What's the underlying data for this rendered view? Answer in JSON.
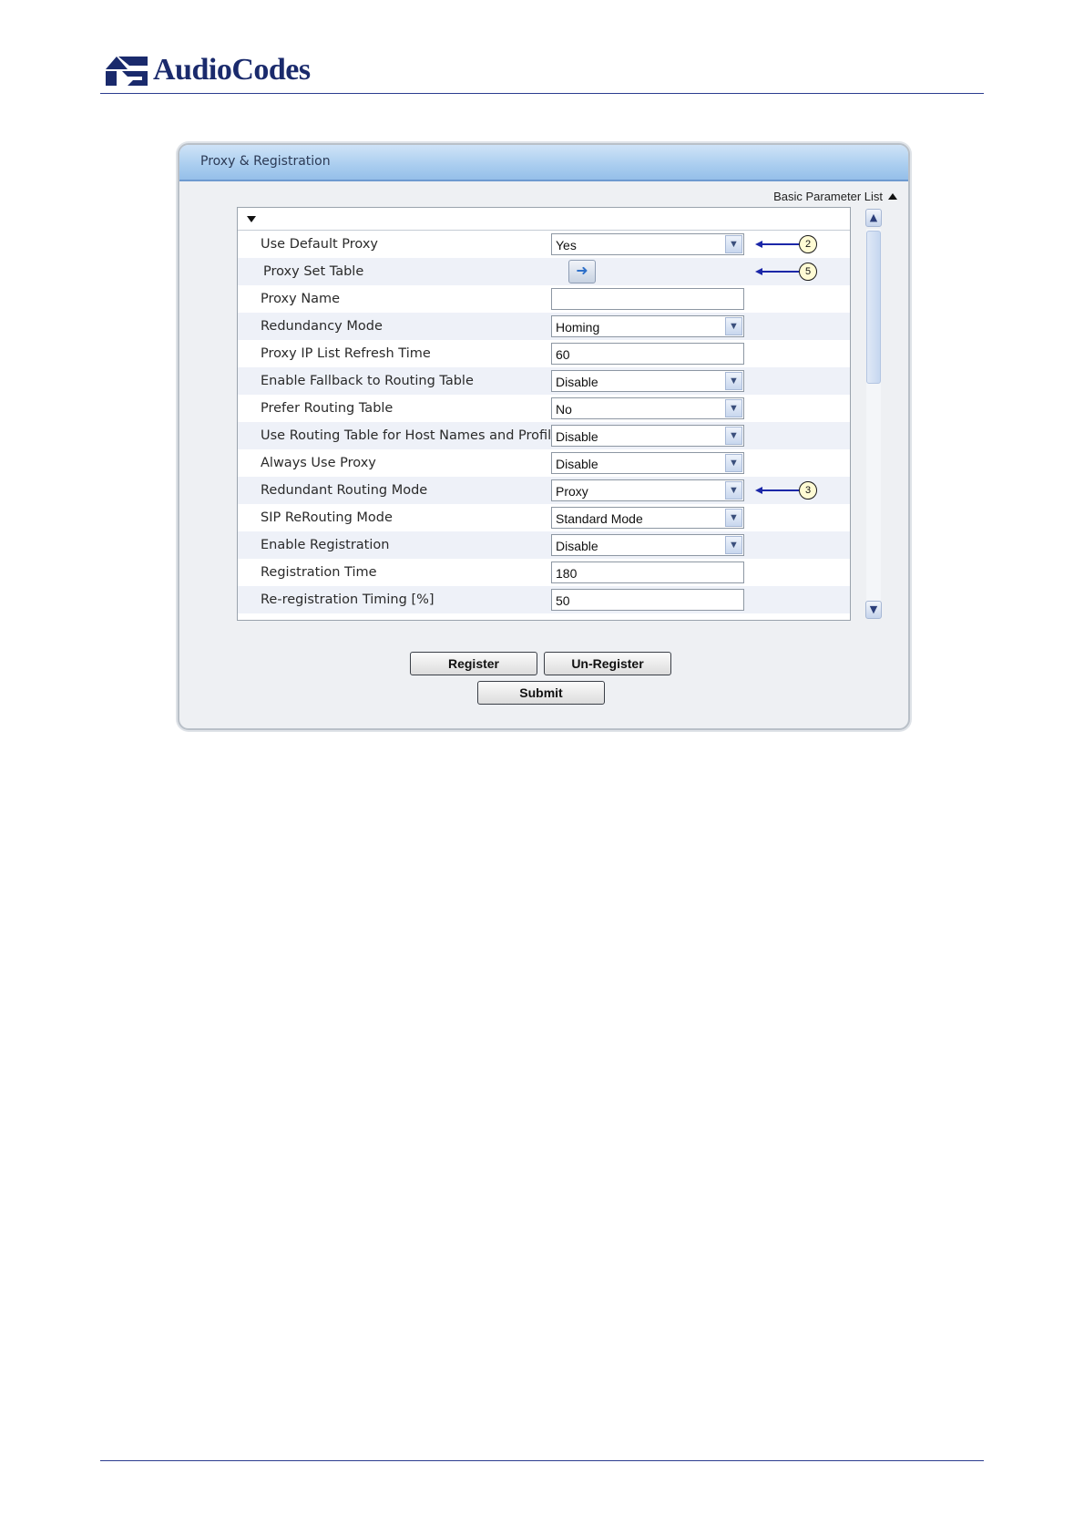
{
  "header": {
    "brand": "AudioCodes",
    "brand_color": "#1a2a6c"
  },
  "panel": {
    "title": "Proxy & Registration",
    "param_list_label": "Basic Parameter List",
    "rows": [
      {
        "label": "Use Default Proxy",
        "type": "select",
        "value": "Yes",
        "callout": "2"
      },
      {
        "label": "Proxy Set Table",
        "type": "button",
        "value": "",
        "callout": "5"
      },
      {
        "label": "Proxy Name",
        "type": "text",
        "value": ""
      },
      {
        "label": "Redundancy Mode",
        "type": "select",
        "value": "Homing"
      },
      {
        "label": "Proxy IP List Refresh Time",
        "type": "text",
        "value": "60"
      },
      {
        "label": "Enable Fallback to Routing Table",
        "type": "select",
        "value": "Disable"
      },
      {
        "label": "Prefer Routing Table",
        "type": "select",
        "value": "No"
      },
      {
        "label": "Use Routing Table for Host Names and Profiles",
        "type": "select",
        "value": "Disable"
      },
      {
        "label": "Always Use Proxy",
        "type": "select",
        "value": "Disable"
      },
      {
        "label": "Redundant Routing Mode",
        "type": "select",
        "value": "Proxy",
        "callout": "3"
      },
      {
        "label": "SIP ReRouting Mode",
        "type": "select",
        "value": "Standard Mode"
      },
      {
        "label": "Enable Registration",
        "type": "select",
        "value": "Disable"
      },
      {
        "label": "Registration Time",
        "type": "text",
        "value": "180"
      },
      {
        "label": "Re-registration Timing [%]",
        "type": "text",
        "value": "50"
      }
    ],
    "buttons": {
      "register": "Register",
      "unregister": "Un-Register",
      "submit": "Submit"
    }
  }
}
